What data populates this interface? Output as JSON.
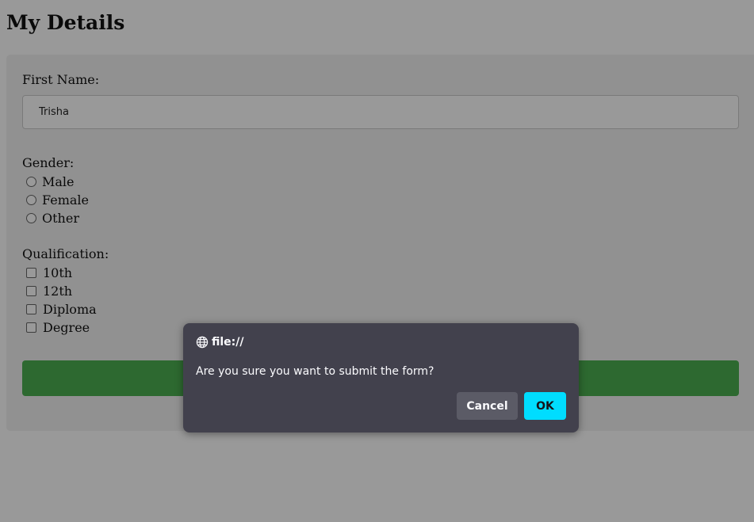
{
  "page": {
    "title": "My Details"
  },
  "form": {
    "first_name_label": "First Name:",
    "first_name_value": "Trisha",
    "gender_label": "Gender:",
    "gender_options": [
      "Male",
      "Female",
      "Other"
    ],
    "qualification_label": "Qualification:",
    "qualification_options": [
      "10th",
      "12th",
      "Diploma",
      "Degree"
    ],
    "submit_color": "#4caf50"
  },
  "dialog": {
    "origin": "file://",
    "message": "Are you sure you want to submit the form?",
    "cancel_label": "Cancel",
    "ok_label": "OK",
    "ok_color": "#00ddff",
    "icon": "globe-icon"
  }
}
